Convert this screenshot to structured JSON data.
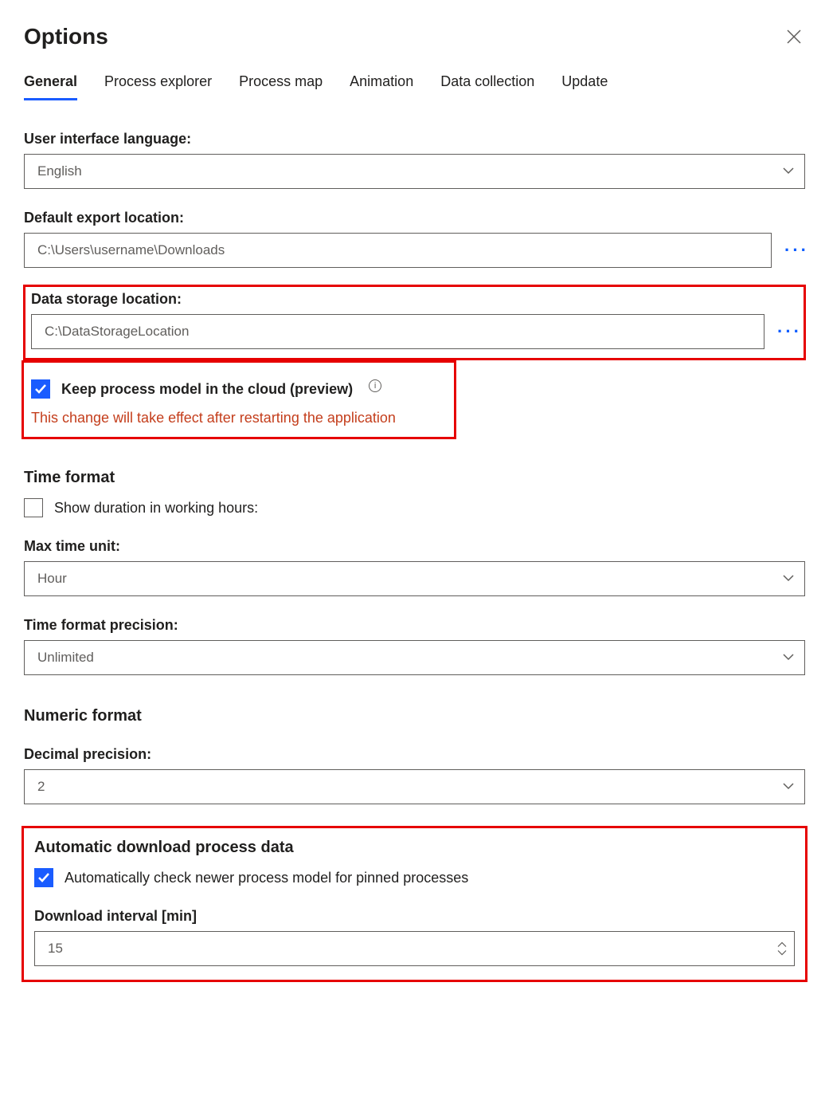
{
  "title": "Options",
  "tabs": [
    {
      "label": "General",
      "active": true
    },
    {
      "label": "Process explorer"
    },
    {
      "label": "Process map"
    },
    {
      "label": "Animation"
    },
    {
      "label": "Data collection"
    },
    {
      "label": "Update"
    }
  ],
  "ui_language": {
    "label": "User interface language:",
    "value": "English"
  },
  "export_location": {
    "label": "Default export location:",
    "value": "C:\\Users\\username\\Downloads"
  },
  "storage_location": {
    "label": "Data storage location:",
    "value": "C:\\DataStorageLocation"
  },
  "keep_cloud": {
    "label": "Keep process model in the cloud (preview)",
    "checked": true,
    "warning": "This change will take effect after restarting the application"
  },
  "time_format": {
    "title": "Time format",
    "show_working_hours": {
      "label": "Show duration in working hours:",
      "checked": false
    },
    "max_unit": {
      "label": "Max time unit:",
      "value": "Hour"
    },
    "precision": {
      "label": "Time format precision:",
      "value": "Unlimited"
    }
  },
  "numeric_format": {
    "title": "Numeric format",
    "decimal_precision": {
      "label": "Decimal precision:",
      "value": "2"
    }
  },
  "auto_download": {
    "title": "Automatic download process data",
    "auto_check": {
      "label": "Automatically check newer process model for pinned processes",
      "checked": true
    },
    "interval": {
      "label": "Download interval [min]",
      "value": "15"
    }
  }
}
